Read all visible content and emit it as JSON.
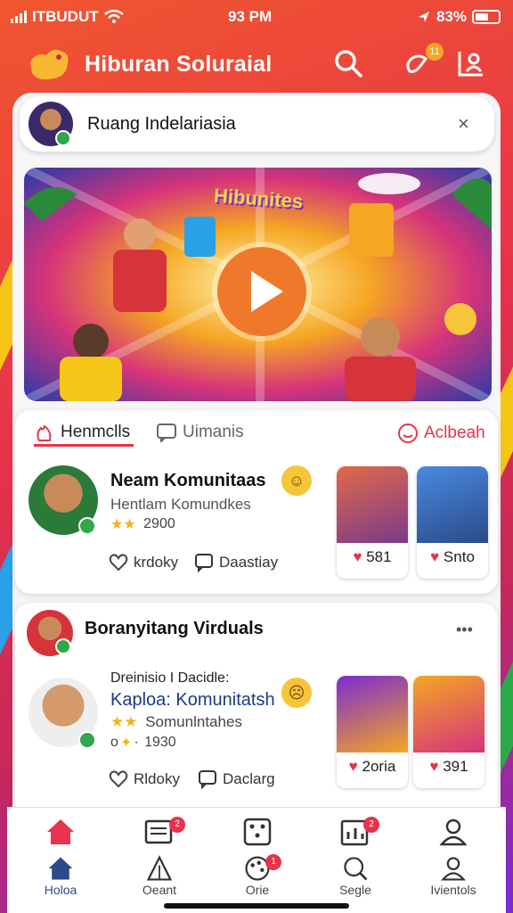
{
  "status_bar": {
    "carrier": "ITBUDUT",
    "time": "93 PM",
    "battery": "83%"
  },
  "header": {
    "title": "Hiburan Soluraial",
    "notif_count": "11"
  },
  "search_banner": {
    "title": "Ruang Indelariasia",
    "close": "×"
  },
  "video": {
    "title": "Hibunites"
  },
  "tabs": {
    "tab1": "Henmclls",
    "tab2": "Uimanis",
    "tab3": "Aclbeah"
  },
  "post1": {
    "name": "Neam Komunitaas",
    "sub": "Hentlam Komundkes",
    "stat": "2900",
    "like_label": "krdoky",
    "comment_label": "Daastiay",
    "thumbs": [
      {
        "count": "581"
      },
      {
        "count": "Snto"
      }
    ]
  },
  "section2": {
    "title": "Boranyitang Virduals",
    "more": "•••"
  },
  "post2": {
    "header": "Dreinisio I Dacidle:",
    "name": "Kaploa: Komunitatsh",
    "sub": "Somunlntahes",
    "stat": "1930",
    "stat_prefix": "o",
    "like_label": "Rldoky",
    "comment_label": "Daclarg",
    "thumbs": [
      {
        "count": "2oria"
      },
      {
        "count": "391"
      }
    ]
  },
  "nav": {
    "items": [
      {
        "label": "Holoa"
      },
      {
        "label": "Oeant",
        "badge": "2"
      },
      {
        "label": "Orie",
        "badge": "1"
      },
      {
        "label": "Segle",
        "badge": "2"
      },
      {
        "label": "Ivientols"
      }
    ]
  },
  "colors": {
    "accent": "#e8334a",
    "play": "#f0782a",
    "badge_green": "#2ea84a"
  }
}
